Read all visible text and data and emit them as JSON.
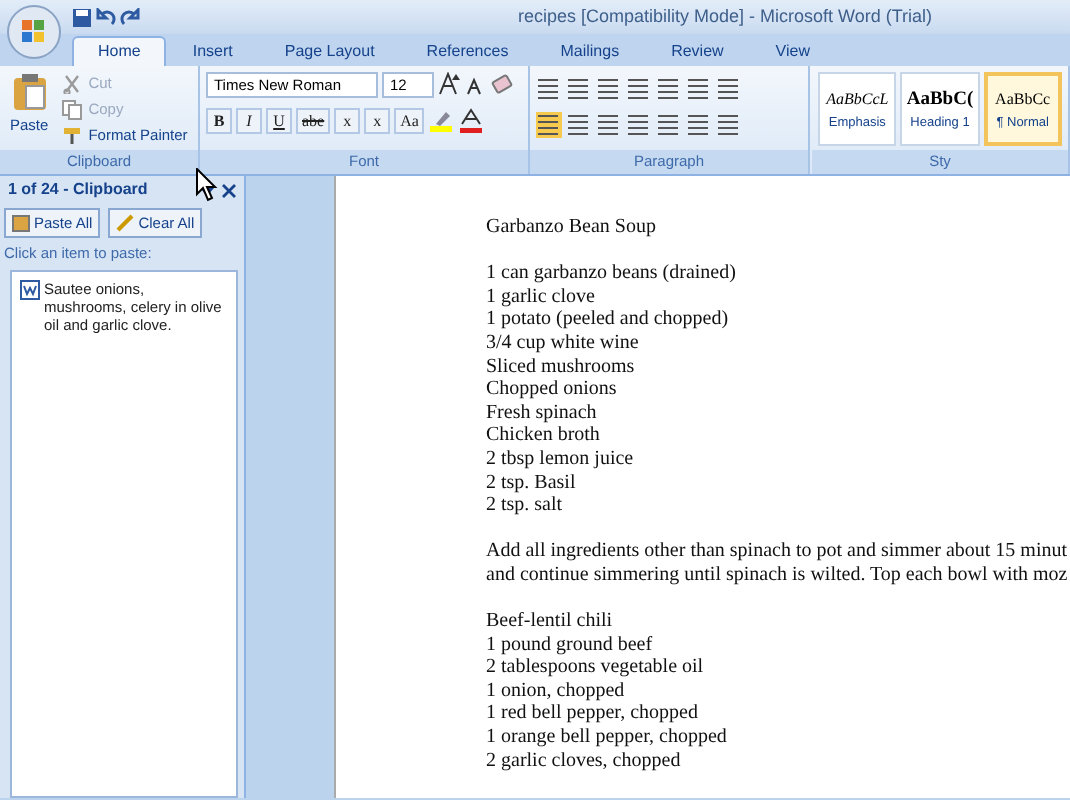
{
  "window": {
    "title": "recipes [Compatibility Mode] - Microsoft Word (Trial)"
  },
  "tabs": [
    {
      "label": "Home",
      "selected": true
    },
    {
      "label": "Insert",
      "selected": false
    },
    {
      "label": "Page Layout",
      "selected": false
    },
    {
      "label": "References",
      "selected": false
    },
    {
      "label": "Mailings",
      "selected": false
    },
    {
      "label": "Review",
      "selected": false
    },
    {
      "label": "View",
      "selected": false
    }
  ],
  "ribbon": {
    "clipboard": {
      "label": "Clipboard",
      "paste": "Paste",
      "commands": [
        {
          "label": "Cut",
          "disabled": true
        },
        {
          "label": "Copy",
          "disabled": true
        },
        {
          "label": "Format Painter",
          "disabled": false
        }
      ]
    },
    "font": {
      "label": "Font",
      "font_name": "Times New Roman",
      "font_size": "12",
      "format_buttons": [
        "B",
        "I",
        "U",
        "abe",
        "x",
        "x",
        "Aa"
      ]
    },
    "paragraph": {
      "label": "Paragraph"
    },
    "styles": {
      "label": "Sty",
      "items": [
        {
          "preview": "AaBbCcL",
          "name": "Emphasis",
          "kind": "italic",
          "selected": false
        },
        {
          "preview": "AaBbC(",
          "name": "Heading 1",
          "kind": "heading",
          "selected": false
        },
        {
          "preview": "AaBbCc",
          "name": "¶ Normal",
          "kind": "normal",
          "selected": true
        }
      ]
    }
  },
  "clipboard_pane": {
    "title": "1 of 24 - Clipboard",
    "buttons": [
      "Paste All",
      "Clear All"
    ],
    "hint": "Click an item to paste:",
    "items": [
      "Sautee onions, mushrooms, celery in olive oil and garlic clove."
    ]
  },
  "document": {
    "blocks": [
      [
        "Garbanzo Bean Soup"
      ],
      [
        "1 can garbanzo beans (drained)",
        "1 garlic clove",
        "1 potato (peeled and chopped)",
        "3/4 cup white wine",
        "Sliced mushrooms",
        "Chopped onions",
        "Fresh spinach",
        "Chicken broth",
        "2 tbsp lemon juice",
        "2 tsp. Basil",
        "2 tsp. salt"
      ],
      [
        "Add all ingredients other than spinach to pot and simmer about 15 minut",
        "and continue simmering  until spinach is wilted. Top each bowl with moz"
      ],
      [
        "Beef-lentil chili",
        "1 pound ground beef",
        "2 tablespoons vegetable oil",
        "1 onion, chopped",
        "1 red bell pepper, chopped",
        "1 orange bell pepper, chopped",
        "2 garlic cloves, chopped"
      ]
    ]
  }
}
